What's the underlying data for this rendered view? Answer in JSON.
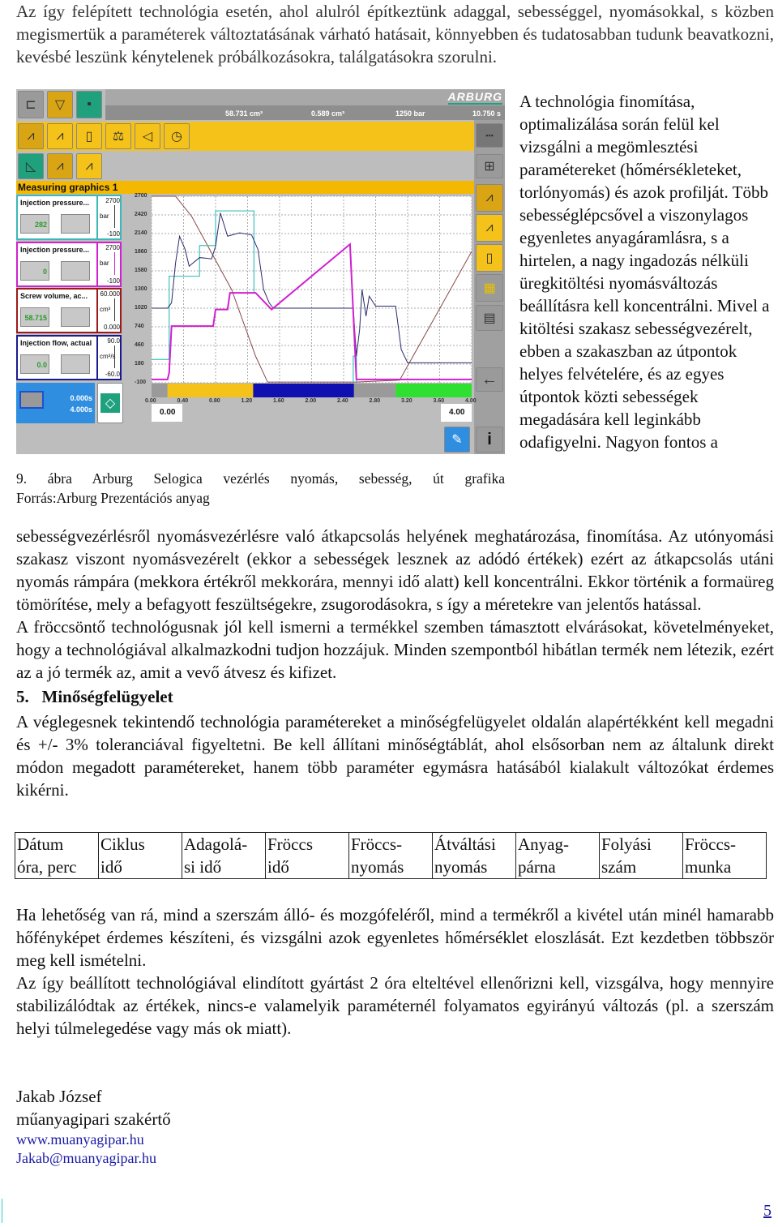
{
  "intro": "Az így felépített technológia esetén, ahol alulról építkeztünk adaggal, sebességgel, nyomásokkal, s közben megismertük a paraméterek változtatásának várható hatásait, könnyebben és tudatosabban tudunk beavatkozni, kevésbé leszünk kénytelenek próbálkozásokra, találgatásokra szorulni.",
  "right_column": "A technológia finomítása, optimalizálása során felül kel vizsgálni a megömlesztési paramétereket (hőmérsékleteket, torlónyomás) és azok profilját. Több sebességlépcsővel a viszonylagos egyenletes anyagáramlásra, s a hirtelen, a nagy ingadozás nélküli üregkitöltési nyomásváltozás beállításra kell koncentrálni. Mivel a kitöltési szakasz sebességvezérelt, ebben a szakaszban az útpontok helyes felvételére, és az egyes útpontok közti sebességek megadására kell leginkább odafigyelni. Nagyon fontos a",
  "caption": {
    "line1": "9. ábra Arburg Selogica vezérlés nyomás, sebesség, út grafika",
    "line2": "Forrás:Arburg Prezentációs anyag"
  },
  "figure": {
    "logo": "ARBURG",
    "status": [
      "58.731 cm³",
      "0.589 cm³",
      "1250 bar",
      "10.750 s"
    ],
    "title": "Measuring graphics 1",
    "panels": [
      {
        "label": "Injection pressure...",
        "value": "282",
        "unit": "bar",
        "max": "2700",
        "min": "-100",
        "color": "#3bb8b8"
      },
      {
        "label": "Injection pressure...",
        "value": "0",
        "unit": "bar",
        "max": "2700",
        "min": "-100",
        "color": "#d020d0"
      },
      {
        "label": "Screw volume, ac...",
        "value": "58.715",
        "unit": "cm³",
        "max": "60.000",
        "min": "0.000",
        "color": "#a01818"
      },
      {
        "label": "Injection flow, actual",
        "value": "0.0",
        "unit": "cm³/s",
        "max": "90.0",
        "min": "-60.0",
        "color": "#1a1a90"
      }
    ],
    "timer": [
      "0.000s",
      "4.000s"
    ],
    "y_ticks": [
      "2700",
      "2420",
      "2140",
      "1860",
      "1580",
      "1300",
      "1020",
      "740",
      "460",
      "180",
      "-100"
    ],
    "x_ticks": [
      "0.00",
      "0.40",
      "0.80",
      "1.20",
      "1.60",
      "2.00",
      "2.40",
      "2.80",
      "3.20",
      "3.60",
      "4.00"
    ],
    "x_start": "0.00",
    "x_end": "4.00",
    "colors": {
      "actual_pressure": "#2a2a6a",
      "set_pressure": "#40c0c0",
      "pressure2": "#d020d0",
      "screw_volume": "#8a4a4a"
    }
  },
  "para2": "sebességvezérlésről nyomásvezérlésre való átkapcsolás helyének meghatározása, finomítása. Az utónyomási szakasz viszont nyomásvezérelt (ekkor a sebességek lesznek az adódó értékek) ezért az átkapcsolás utáni nyomás rámpára (mekkora értékről mekkorára, mennyi idő alatt) kell koncentrálni. Ekkor történik a formaüreg tömörítése, mely a befagyott feszültségekre, zsugorodásokra, s így a méretekre van jelentős hatással.",
  "para3": "A fröccsöntő technológusnak jól kell ismerni a termékkel szemben támasztott elvárásokat, követelményeket, hogy a technológiával alkalmazkodni tudjon hozzájuk. Minden szempontból hibátlan termék nem létezik, ezért az a jó termék az, amit a vevő átvesz és kifizet.",
  "heading": "5.   Minőségfelügyelet",
  "para4": "A véglegesnek tekintendő technológia paramétereket a minőségfelügyelet oldalán alapértékként kell megadni és +/- 3% toleranciával figyeltetni. Be kell állítani minőségtáblát, ahol elsősorban nem az általunk direkt módon megadott paramétereket, hanem több paraméter egymásra hatásából kialakult változókat érdemes kikérni.",
  "table_headers": [
    [
      "Dátum",
      "óra, perc"
    ],
    [
      "Ciklus",
      "idő"
    ],
    [
      "Adagolá-",
      "si idő"
    ],
    [
      "Fröccs",
      "idő"
    ],
    [
      "Fröccs-",
      "nyomás"
    ],
    [
      "Átváltási",
      "nyomás"
    ],
    [
      "Anyag-",
      "párna"
    ],
    [
      "Folyási",
      "szám"
    ],
    [
      "Fröccs-",
      "munka"
    ]
  ],
  "para5": "Ha lehetőség van rá, mind a szerszám álló- és mozgófeléről, mind a termékről a kivétel után minél hamarabb hőfényképet érdemes készíteni, és vizsgálni azok egyenletes hőmérséklet eloszlását. Ezt kezdetben többször meg kell ismételni.",
  "para6": "Az így beállított technológiával elindított gyártást 2 óra elteltével ellenőrizni kell, vizsgálva, hogy mennyire stabilizálódtak az értékek, nincs-e valamelyik paraméternél folyamatos egyirányú változás (pl. a szerszám helyi túlmelegedése vagy más ok miatt).",
  "signature": {
    "name": "Jakab József",
    "title": "műanyagipari szakértő",
    "web": "www.muanyagipar.hu",
    "email": "Jakab@muanyagipar.hu"
  },
  "page_number": "5"
}
